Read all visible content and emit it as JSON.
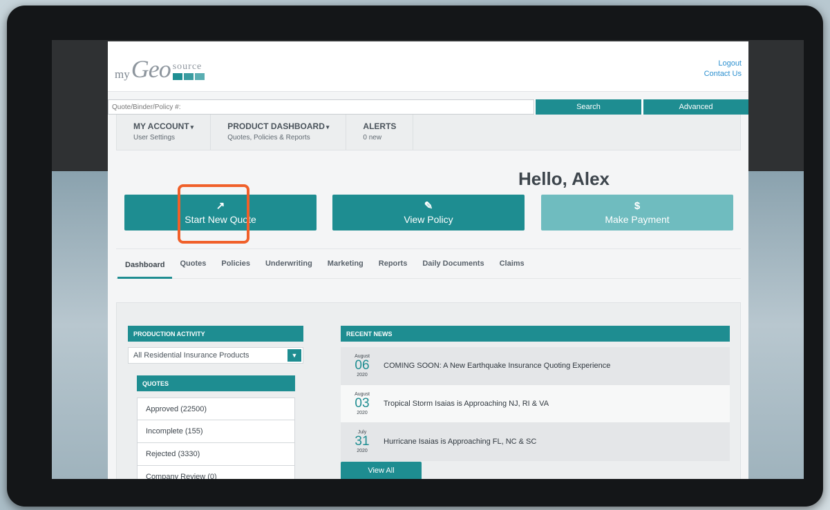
{
  "header": {
    "logo": {
      "prefix": "my",
      "main": "Geo",
      "suffix": "source"
    },
    "links": {
      "logout": "Logout",
      "contact": "Contact Us"
    }
  },
  "search": {
    "placeholder": "Quote/Binder/Policy #:",
    "search_label": "Search",
    "advanced_label": "Advanced"
  },
  "topnav": [
    {
      "title": "MY ACCOUNT",
      "sub": "User Settings",
      "caret": "▾"
    },
    {
      "title": "PRODUCT DASHBOARD",
      "sub": "Quotes, Policies & Reports",
      "caret": "▾"
    },
    {
      "title": "ALERTS",
      "sub": "0 new",
      "caret": ""
    }
  ],
  "greeting": "Hello, Alex",
  "actions": [
    {
      "icon": "external-link-icon",
      "glyph": "↗",
      "label": "Start New Quote"
    },
    {
      "icon": "edit-icon",
      "glyph": "✎",
      "label": "View Policy"
    },
    {
      "icon": "dollar-icon",
      "glyph": "$",
      "label": "Make Payment"
    }
  ],
  "tabs": [
    "Dashboard",
    "Quotes",
    "Policies",
    "Underwriting",
    "Marketing",
    "Reports",
    "Daily Documents",
    "Claims"
  ],
  "active_tab": "Dashboard",
  "production": {
    "title": "PRODUCTION ACTIVITY",
    "selected_product": "All Residential Insurance Products",
    "quotes_title": "QUOTES",
    "quotes": [
      "Approved (22500)",
      "Incomplete (155)",
      "Rejected (3330)",
      "Company Review (0)"
    ]
  },
  "news": {
    "title": "RECENT NEWS",
    "items": [
      {
        "month": "August",
        "day": "06",
        "year": "2020",
        "headline": "COMING SOON: A New Earthquake Insurance Quoting Experience"
      },
      {
        "month": "August",
        "day": "03",
        "year": "2020",
        "headline": "Tropical Storm Isaias is Approaching NJ, RI & VA"
      },
      {
        "month": "July",
        "day": "31",
        "year": "2020",
        "headline": "Hurricane Isaias is Approaching FL, NC & SC"
      }
    ],
    "view_all": "View All"
  },
  "colors": {
    "teal": "#1e8d91",
    "teal_light": "#6fbcbf",
    "highlight": "#f0602a",
    "link": "#2b8fcf"
  }
}
